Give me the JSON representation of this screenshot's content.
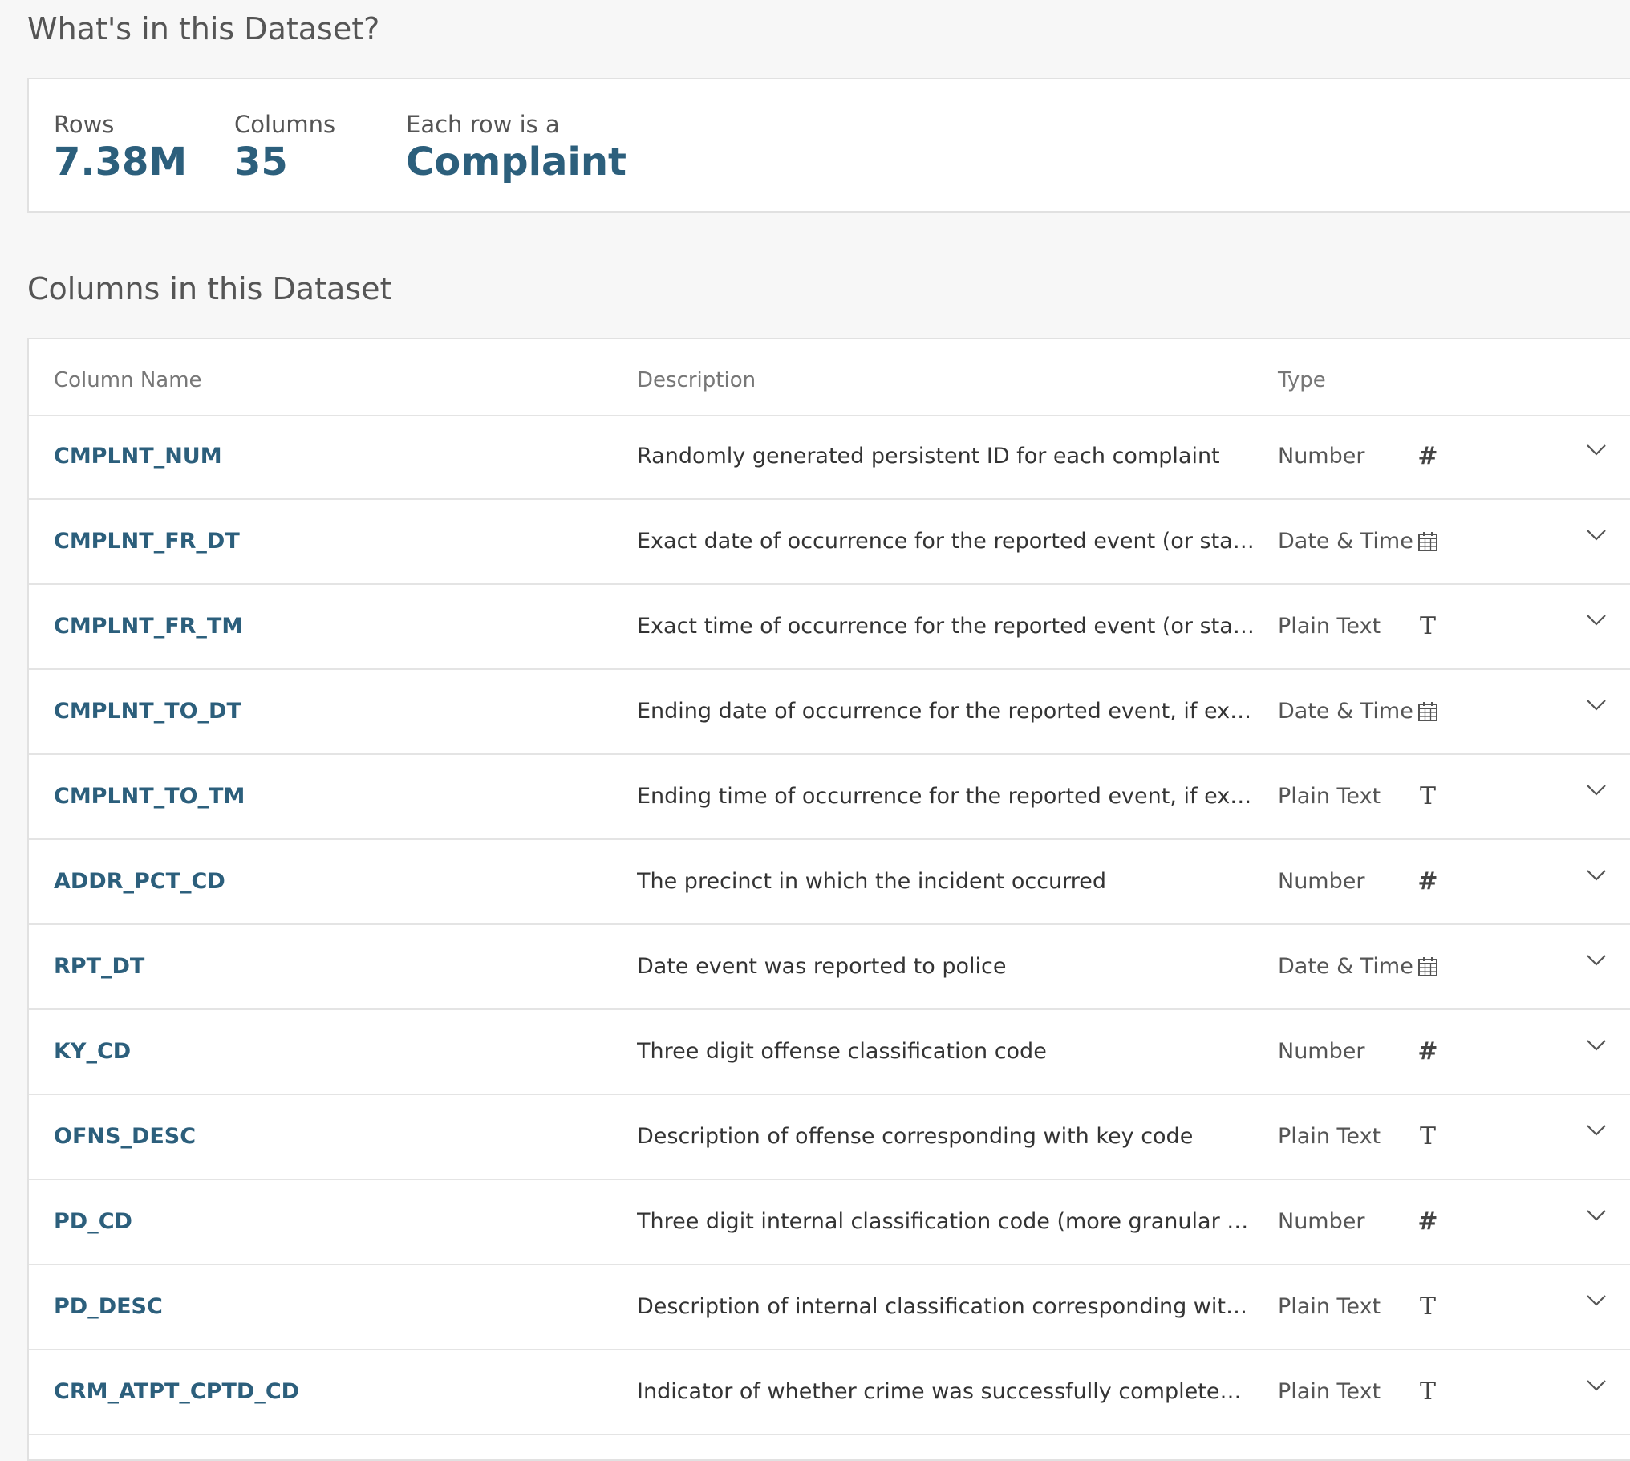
{
  "summary": {
    "title": "What's in this Dataset?",
    "rows_label": "Rows",
    "rows_value": "7.38M",
    "columns_label": "Columns",
    "columns_value": "35",
    "row_kind_label": "Each row is a",
    "row_kind_value": "Complaint"
  },
  "columns_section": {
    "title": "Columns in this Dataset",
    "headers": {
      "name": "Column Name",
      "description": "Description",
      "type": "Type"
    },
    "rows": [
      {
        "name": "CMPLNT_NUM",
        "description": "Randomly generated persistent ID for each complaint",
        "type": "Number",
        "icon": "number-icon"
      },
      {
        "name": "CMPLNT_FR_DT",
        "description": "Exact date of occurrence for the reported event (or starting...",
        "type": "Date & Time",
        "icon": "calendar-icon"
      },
      {
        "name": "CMPLNT_FR_TM",
        "description": "Exact time of occurrence for the reported event (or starting...",
        "type": "Plain Text",
        "icon": "text-icon"
      },
      {
        "name": "CMPLNT_TO_DT",
        "description": "Ending date of occurrence for the reported event, if exact ti...",
        "type": "Date & Time",
        "icon": "calendar-icon"
      },
      {
        "name": "CMPLNT_TO_TM",
        "description": "Ending time of occurrence for the reported event, if exact ti...",
        "type": "Plain Text",
        "icon": "text-icon"
      },
      {
        "name": "ADDR_PCT_CD",
        "description": "The precinct in which the incident occurred",
        "type": "Number",
        "icon": "number-icon"
      },
      {
        "name": "RPT_DT",
        "description": "Date event was reported to police",
        "type": "Date & Time",
        "icon": "calendar-icon"
      },
      {
        "name": "KY_CD",
        "description": "Three digit offense classification code",
        "type": "Number",
        "icon": "number-icon"
      },
      {
        "name": "OFNS_DESC",
        "description": "Description of offense corresponding with key code",
        "type": "Plain Text",
        "icon": "text-icon"
      },
      {
        "name": "PD_CD",
        "description": "Three digit internal classification code (more granular than ...",
        "type": "Number",
        "icon": "number-icon"
      },
      {
        "name": "PD_DESC",
        "description": "Description of internal classification corresponding with PD...",
        "type": "Plain Text",
        "icon": "text-icon"
      },
      {
        "name": "CRM_ATPT_CPTD_CD",
        "description": "Indicator of whether crime was successfully completed or ...",
        "type": "Plain Text",
        "icon": "text-icon"
      }
    ]
  },
  "colors": {
    "accent": "#2c5f7c",
    "background": "#f7f7f7",
    "card": "#ffffff",
    "border": "#e1e1e1"
  }
}
